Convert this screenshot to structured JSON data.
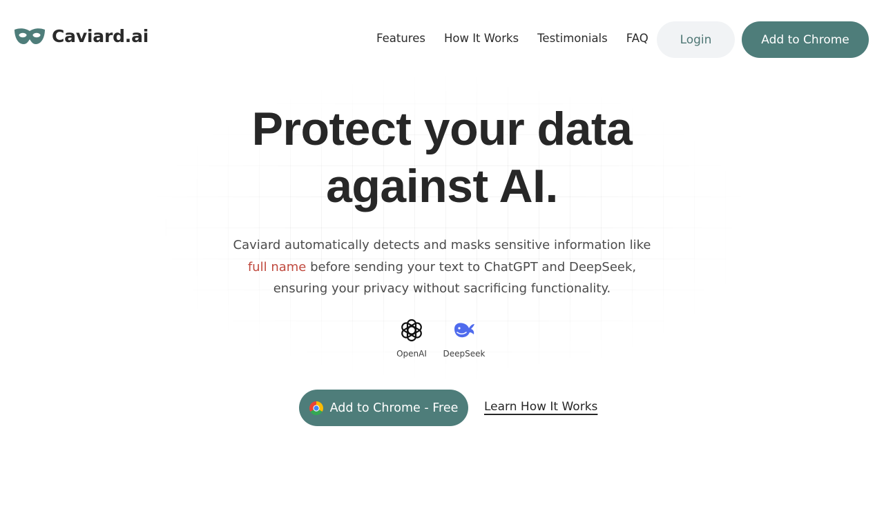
{
  "brand": {
    "name": "Caviard.ai",
    "logo_icon": "mask-icon",
    "accent_color": "#4e7d7a"
  },
  "nav": {
    "links": [
      "Features",
      "How It Works",
      "Testimonials",
      "FAQ"
    ],
    "login_label": "Login",
    "add_to_chrome_label": "Add to Chrome"
  },
  "hero": {
    "title_line1": "Protect your data",
    "title_line2": "against AI.",
    "subtitle_part1": "Caviard automatically detects and masks sensitive information like",
    "subtitle_highlight": "full name",
    "subtitle_part2": "before sending your text to ChatGPT and DeepSeek, ensuring your privacy without sacrificing functionality.",
    "highlight_color": "#c0493e",
    "providers": [
      {
        "label": "OpenAI",
        "icon": "openai-icon"
      },
      {
        "label": "DeepSeek",
        "icon": "deepseek-whale-icon"
      }
    ],
    "cta_primary_label": "Add to Chrome - Free",
    "cta_primary_icon": "chrome-icon",
    "cta_secondary_label": "Learn How It Works"
  }
}
